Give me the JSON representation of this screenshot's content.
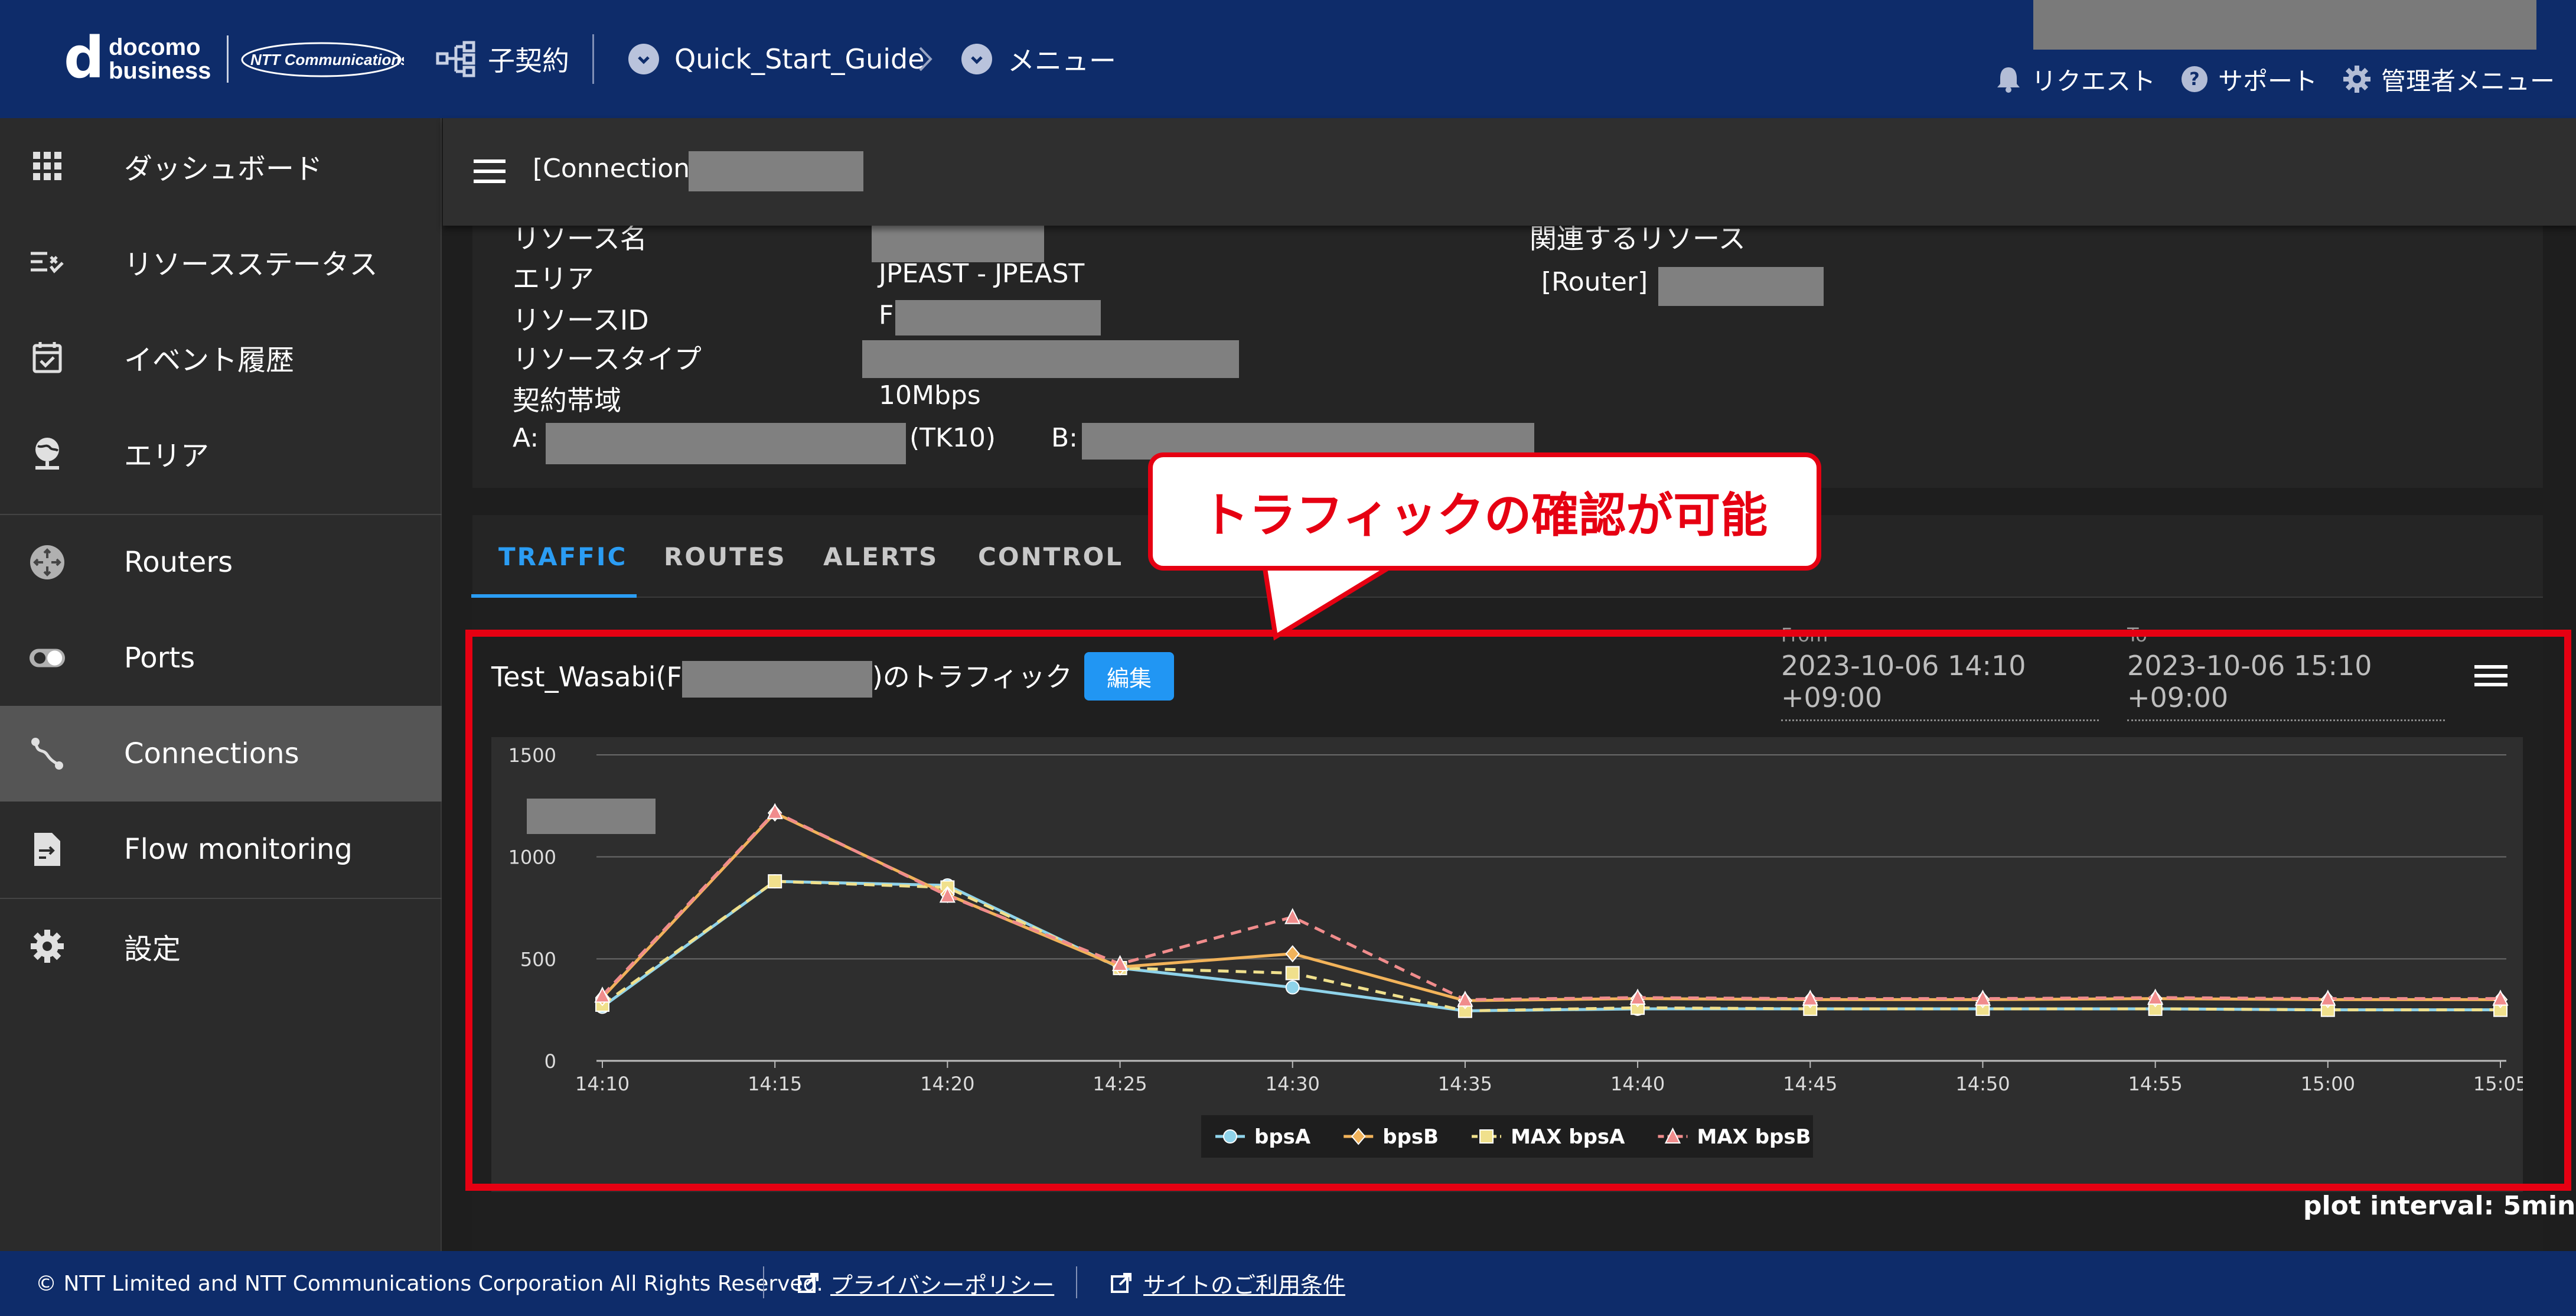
{
  "header": {
    "brand_line1": "docomo",
    "brand_line2": "business",
    "ntt_logo_text": "NTT Communications",
    "contract_label": "子契約",
    "breadcrumb_1": "Quick_Start_Guide",
    "breadcrumb_2": "メニュー",
    "request_label": "リクエスト",
    "support_label": "サポート",
    "admin_menu_label": "管理者メニュー"
  },
  "sidebar": {
    "items": [
      {
        "label": "ダッシュボード",
        "icon": "grid-icon"
      },
      {
        "label": "リソースステータス",
        "icon": "checklist-icon"
      },
      {
        "label": "イベント履歴",
        "icon": "calendar-check-icon"
      },
      {
        "label": "エリア",
        "icon": "globe-icon"
      },
      {
        "label": "Routers",
        "icon": "router-icon"
      },
      {
        "label": "Ports",
        "icon": "port-icon"
      },
      {
        "label": "Connections",
        "icon": "connection-icon"
      },
      {
        "label": "Flow monitoring",
        "icon": "flow-file-icon"
      },
      {
        "label": "設定",
        "icon": "gear-icon"
      }
    ],
    "active": "Connections"
  },
  "topbar": {
    "title": "[Connection]"
  },
  "info": {
    "resource_name_label": "リソース名",
    "area_label": "エリア",
    "area_value": "JPEAST - JPEAST",
    "resource_id_label": "リソースID",
    "resource_id_prefix": "F",
    "resource_type_label": "リソースタイプ",
    "bandwidth_label": "契約帯域",
    "bandwidth_value": "10Mbps",
    "endpoint_a_label": "A:",
    "endpoint_a_suffix": "(TK10)",
    "endpoint_b_label": "B:",
    "related_label": "関連するリソース",
    "related_router": "[Router]"
  },
  "tabs": [
    "TRAFFIC",
    "ROUTES",
    "ALERTS",
    "CONTROL"
  ],
  "active_tab": "TRAFFIC",
  "callout_text": "トラフィックの確認が可能",
  "chart_panel": {
    "title_prefix": "Test_Wasabi(F",
    "title_suffix": ")のトラフィック",
    "edit_label": "編集",
    "from_label": "From",
    "from_value": "2023-10-06 14:10 +09:00",
    "to_label": "To",
    "to_value": "2023-10-06 15:10 +09:00",
    "plot_interval": "plot interval: 5min"
  },
  "chart_data": {
    "type": "line",
    "x": [
      "14:10",
      "14:15",
      "14:20",
      "14:25",
      "14:30",
      "14:35",
      "14:40",
      "14:45",
      "14:50",
      "14:55",
      "15:00",
      "15:05"
    ],
    "ylim": [
      0,
      1500
    ],
    "yticks": [
      0,
      500,
      1000,
      1500
    ],
    "grid": true,
    "legend_position": "bottom",
    "series": [
      {
        "name": "bpsA",
        "color": "#8fd3ea",
        "dashed": false,
        "marker": "circle",
        "values": [
          265,
          880,
          860,
          455,
          360,
          245,
          255,
          255,
          255,
          255,
          250,
          250
        ]
      },
      {
        "name": "bpsB",
        "color": "#f2b35a",
        "dashed": false,
        "marker": "diamond",
        "values": [
          310,
          1215,
          815,
          460,
          525,
          295,
          305,
          300,
          300,
          305,
          300,
          300
        ]
      },
      {
        "name": "MAX bpsA",
        "color": "#f0e08c",
        "dashed": true,
        "marker": "square",
        "values": [
          275,
          880,
          850,
          455,
          430,
          245,
          260,
          255,
          255,
          255,
          250,
          250
        ]
      },
      {
        "name": "MAX bpsB",
        "color": "#f08c8c",
        "dashed": true,
        "marker": "triangle",
        "values": [
          320,
          1220,
          810,
          475,
          705,
          300,
          310,
          305,
          305,
          310,
          305,
          305
        ]
      }
    ]
  },
  "footer": {
    "copyright": "© NTT Limited and NTT Communications Corporation All Rights Reserved.",
    "privacy_link": "プライバシーポリシー",
    "terms_link": "サイトのご利用条件"
  }
}
